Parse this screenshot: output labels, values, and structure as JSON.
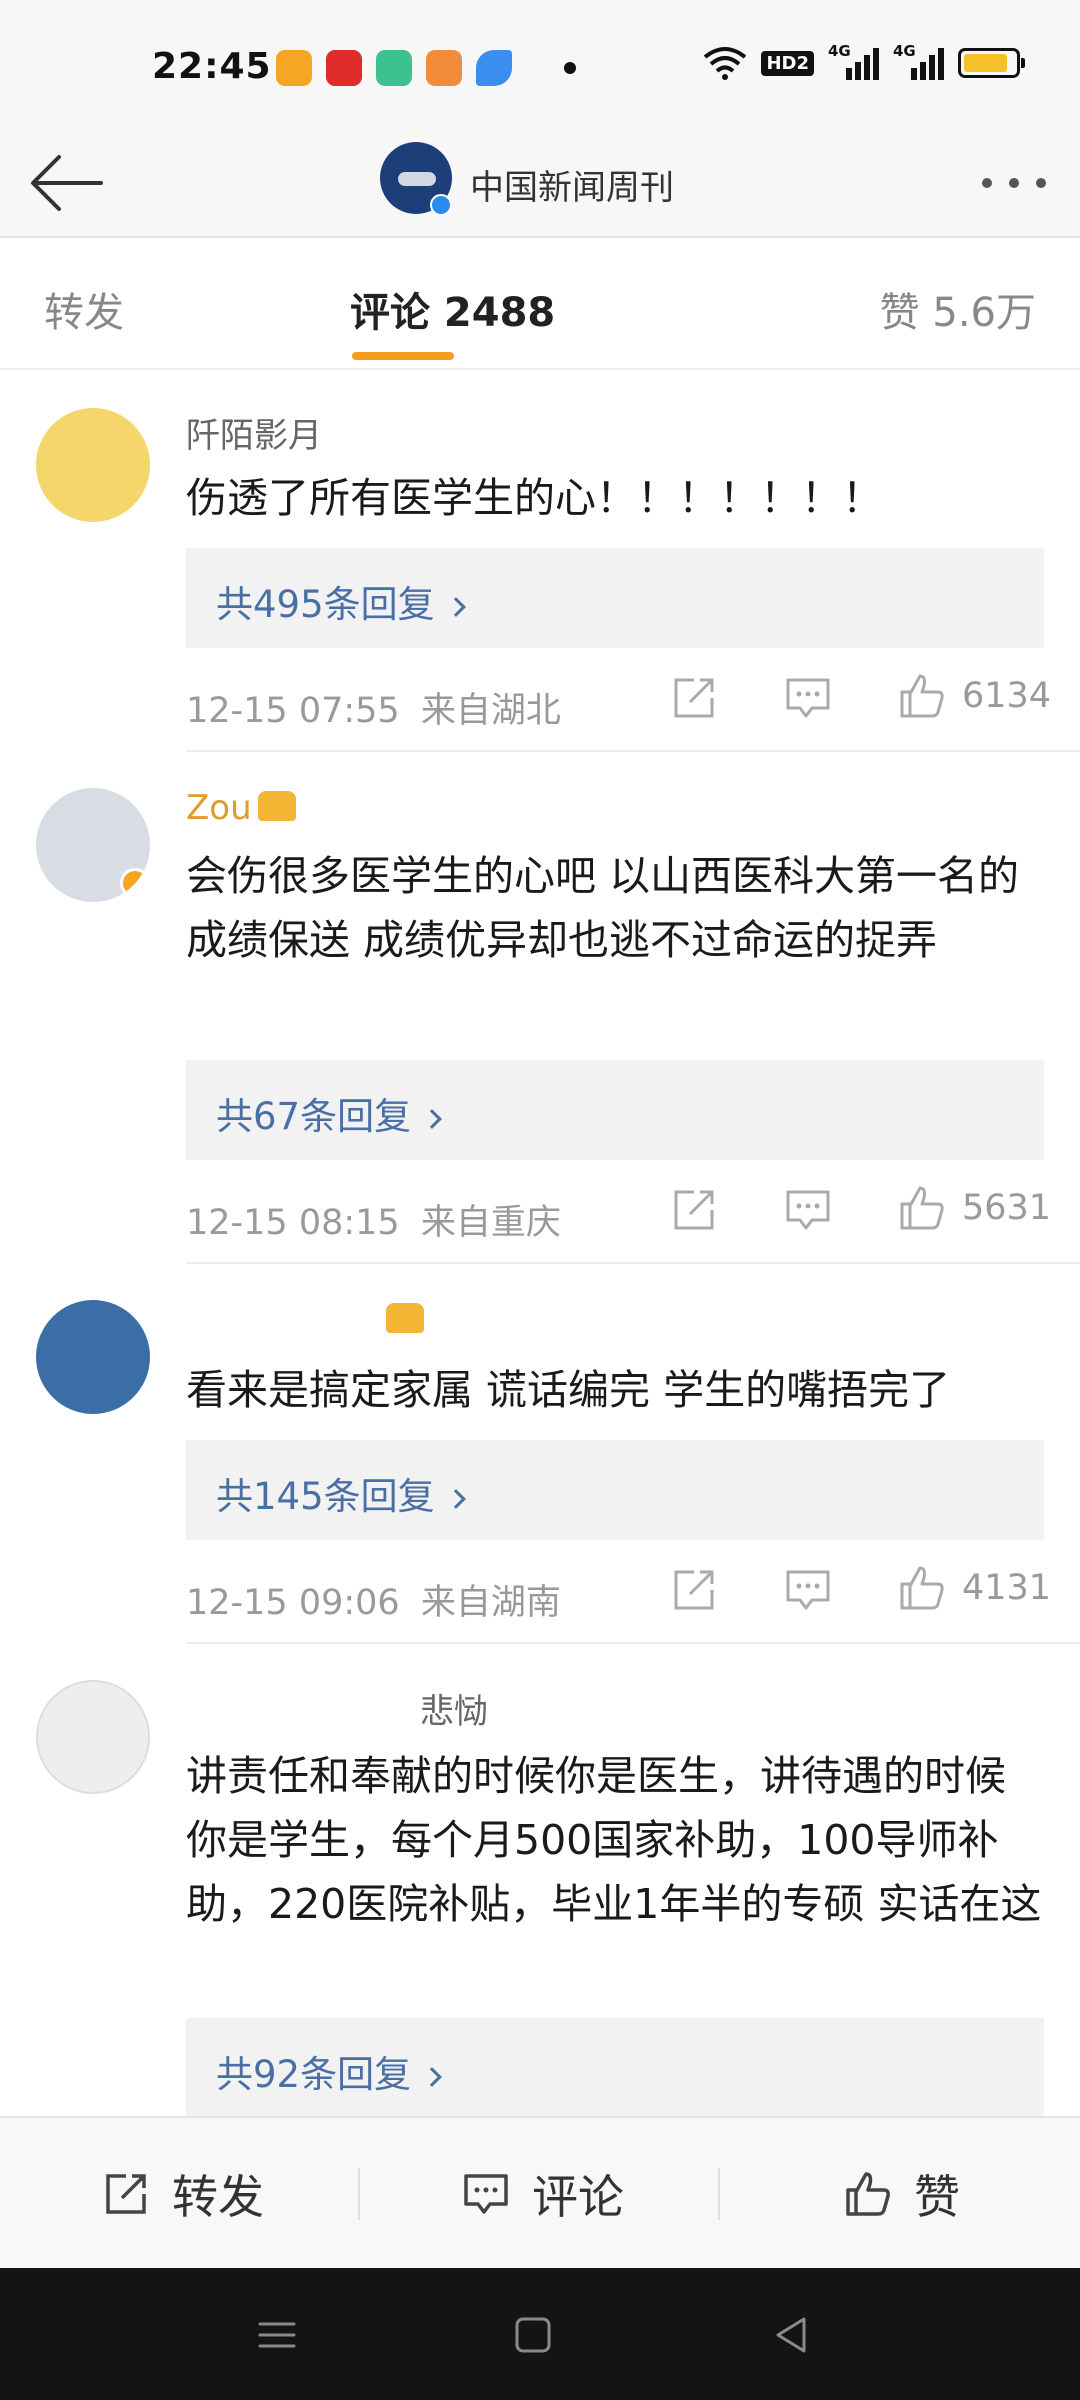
{
  "status_bar": {
    "time": "22:45",
    "notification_icons": [
      {
        "name": "weibo-app-icon",
        "color": "#f5a623"
      },
      {
        "name": "netease-music-app-icon",
        "color": "#e02b2b"
      },
      {
        "name": "green-app-icon",
        "color": "#3bc28e"
      },
      {
        "name": "reader-app-icon",
        "color": "#f28c3b"
      },
      {
        "name": "blue-app-icon",
        "color": "#3a8ef0"
      }
    ],
    "hd_label": "HD2",
    "signal_1_label": "4G",
    "signal_2_label": "4G",
    "battery_level": 0.85,
    "battery_color": "#f5c02a"
  },
  "nav": {
    "title": "中国新闻周刊",
    "back_icon": "back-arrow-icon",
    "more_icon": "more-dots-icon"
  },
  "tabs": {
    "repost": "转发",
    "comment": "评论 2488",
    "like": "赞 5.6万",
    "active": "comment",
    "indicator_color": "#f59b20"
  },
  "comments": [
    {
      "username": "阡陌影月",
      "text": "伤透了所有医学生的心！！！！！！！",
      "reply_label": "共495条回复",
      "time": "12-15 07:55",
      "location": "来自湖北",
      "likes": "6134",
      "avatar_color": "#f5d66b",
      "vip": false,
      "verified": false
    },
    {
      "username": "Zou",
      "text": "会伤很多医学生的心吧 以山西医科大第一名的成绩保送 成绩优异却也逃不过命运的捉弄",
      "reply_label": "共67条回复",
      "time": "12-15 08:15",
      "location": "来自重庆",
      "likes": "5631",
      "avatar_color": "#d7dde3",
      "vip": true,
      "verified": true
    },
    {
      "username": "",
      "text": "看来是搞定家属 谎话编完 学生的嘴捂完了",
      "reply_label": "共145条回复",
      "time": "12-15 09:06",
      "location": "来自湖南",
      "likes": "4131",
      "avatar_color": "#3a6ea5",
      "vip": true,
      "verified": false
    },
    {
      "username": "悲恸",
      "text": "讲责任和奉献的时候你是医生，讲待遇的时候你是学生，每个月500国家补助，100导师补助，220医院补贴，毕业1年半的专硕 实话在这",
      "reply_label": "共92条回复",
      "avatar_color": "#eeeeee",
      "vip": false,
      "verified": false
    }
  ],
  "bottom_bar": {
    "repost": "转发",
    "comment": "评论",
    "like": "赞"
  },
  "system_nav": {
    "menu_icon": "menu-lines-icon",
    "home_icon": "home-square-icon",
    "back_icon": "back-triangle-icon"
  }
}
